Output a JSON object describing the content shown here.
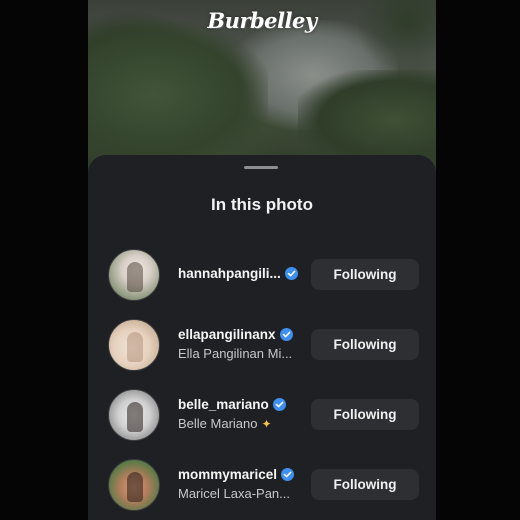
{
  "watermark": "Burbelley",
  "sheet": {
    "title": "In this photo"
  },
  "people": [
    {
      "username": "hannahpangili...",
      "verified": true,
      "full_name": "",
      "button": "Following"
    },
    {
      "username": "ellapangilinanx",
      "verified": true,
      "full_name": "Ella Pangilinan Mi...",
      "button": "Following"
    },
    {
      "username": "belle_mariano",
      "verified": true,
      "full_name": "Belle Mariano",
      "full_name_emoji": "sparkle-emoji",
      "button": "Following"
    },
    {
      "username": "mommymaricel",
      "verified": true,
      "full_name": "Maricel Laxa-Pan...",
      "button": "Following"
    }
  ],
  "colors": {
    "sheet_bg": "#1f2023",
    "button_bg": "#2e2f33",
    "verified_badge": "#3d8ff0"
  }
}
